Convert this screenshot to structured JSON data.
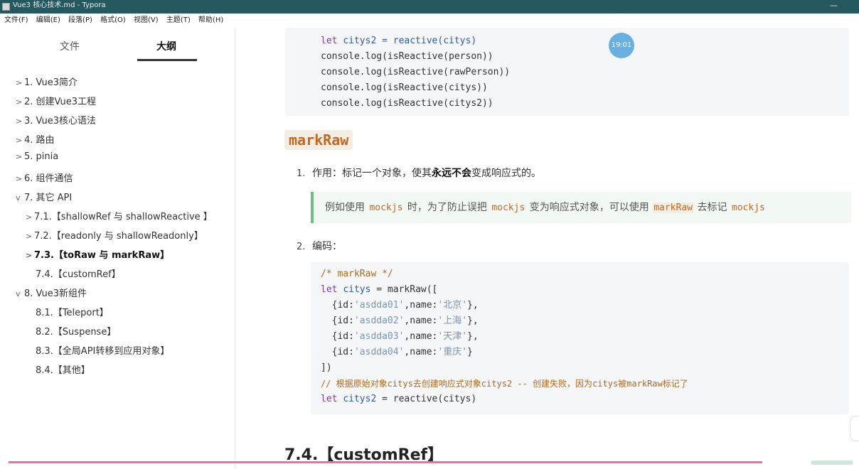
{
  "window": {
    "title": "Vue3 核心技术.md - Typora",
    "minimize": "—"
  },
  "menu": [
    "文件(F)",
    "编辑(E)",
    "段落(P)",
    "格式(O)",
    "视图(V)",
    "主题(T)",
    "帮助(H)"
  ],
  "sidebar": {
    "tab_files": "文件",
    "tab_outline": "大纲",
    "items": [
      {
        "chev": ">",
        "label": "1. Vue3简介"
      },
      {
        "chev": ">",
        "label": "2. 创建Vue3工程"
      },
      {
        "chev": ">",
        "label": "3. Vue3核心语法"
      },
      {
        "chev": ">",
        "label": "4. 路由"
      },
      {
        "chev": ">",
        "label": "5. pinia"
      },
      {
        "chev": ">",
        "label": "6. 组件通信"
      },
      {
        "chev": "v",
        "label": "7. 其它 API"
      },
      {
        "chev": ">",
        "label": "7.1.【shallowRef 与 shallowReactive 】"
      },
      {
        "chev": ">",
        "label": "7.2.【readonly 与 shallowReadonly】"
      },
      {
        "chev": ">",
        "label": "7.3.【toRaw 与 markRaw】"
      },
      {
        "chev": "",
        "label": "7.4.【customRef】"
      },
      {
        "chev": "v",
        "label": "8. Vue3新组件"
      },
      {
        "chev": "",
        "label": "8.1.【Teleport】"
      },
      {
        "chev": "",
        "label": "8.2.【Suspense】"
      },
      {
        "chev": "",
        "label": "8.3.【全局API转移到应用对象】"
      },
      {
        "chev": "",
        "label": "8.4.【其他】"
      }
    ]
  },
  "editor": {
    "timestamp": "19:01",
    "code_top": [
      "let citys2 = reactive(citys)",
      "console.log(isReactive(person))",
      "console.log(isReactive(rawPerson))",
      "console.log(isReactive(citys))",
      "console.log(isReactive(citys2))"
    ],
    "heading_markraw": "markRaw",
    "item1_num": "1.",
    "item1_prefix": "作用：标记一个对象，使其",
    "item1_bold": "永远不会",
    "item1_suffix": "变成响应式的。",
    "quote_p1": "例如使用 ",
    "quote_c1": "mockjs",
    "quote_p2": " 时，为了防止误把 ",
    "quote_c2": "mockjs",
    "quote_p3": " 变为响应式对象，可以使用 ",
    "quote_c3": "markRaw",
    "quote_p4": " 去标记 ",
    "quote_c4": "mockjs",
    "item2_num": "2.",
    "item2_text": "编码：",
    "code2": {
      "l1": "/* markRaw */",
      "l2_kw": "let ",
      "l2_var": "citys",
      "l2_rest": " = markRaw([",
      "rows": [
        {
          "pre": "  {id:",
          "id": "'asdda01'",
          "mid": ",name:",
          "name": "'北京'",
          "post": "},"
        },
        {
          "pre": "  {id:",
          "id": "'asdda02'",
          "mid": ",name:",
          "name": "'上海'",
          "post": "},"
        },
        {
          "pre": "  {id:",
          "id": "'asdda03'",
          "mid": ",name:",
          "name": "'天津'",
          "post": "},"
        },
        {
          "pre": "  {id:",
          "id": "'asdda04'",
          "mid": ",name:",
          "name": "'重庆'",
          "post": "}"
        }
      ],
      "l7": "])",
      "l8": "// 根据原始对象citys去创建响应式对象citys2 -- 创建失败，因为citys被markRaw标记了",
      "l9_kw": "let ",
      "l9_var": "citys2",
      "l9_rest": " = reactive(citys)"
    },
    "h2_custom": "7.4.【customRef】"
  }
}
